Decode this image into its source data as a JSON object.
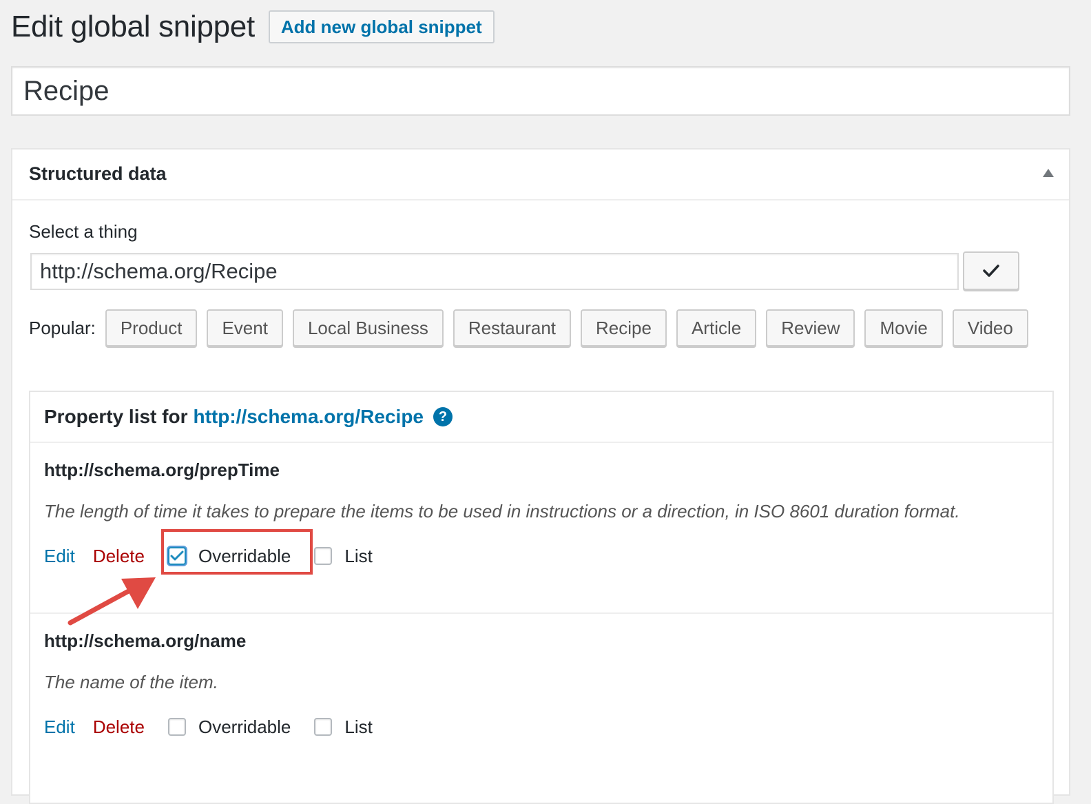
{
  "header": {
    "title": "Edit global snippet",
    "add_new_label": "Add new global snippet"
  },
  "snippet_title": {
    "value": "Recipe"
  },
  "structured_data": {
    "title": "Structured data",
    "select_label": "Select a thing",
    "thing_value": "http://schema.org/Recipe",
    "popular_label": "Popular:",
    "popular_items": [
      "Product",
      "Event",
      "Local Business",
      "Restaurant",
      "Recipe",
      "Article",
      "Review",
      "Movie",
      "Video"
    ]
  },
  "property_list": {
    "header_prefix": "Property list for",
    "header_link": "http://schema.org/Recipe",
    "help_symbol": "?",
    "properties": [
      {
        "name": "http://schema.org/prepTime",
        "description": "The length of time it takes to prepare the items to be used in instructions or a direction, in ISO 8601 duration format.",
        "edit_label": "Edit",
        "delete_label": "Delete",
        "overridable_label": "Overridable",
        "overridable_checked": true,
        "list_label": "List",
        "list_checked": false
      },
      {
        "name": "http://schema.org/name",
        "description": "The name of the item.",
        "edit_label": "Edit",
        "delete_label": "Delete",
        "overridable_label": "Overridable",
        "overridable_checked": false,
        "list_label": "List",
        "list_checked": false
      }
    ]
  },
  "annotation": {
    "highlight_color": "#e04a43"
  },
  "colors": {
    "link": "#0073aa",
    "delete": "#aa0000",
    "accent_check": "#1e8cbe"
  }
}
